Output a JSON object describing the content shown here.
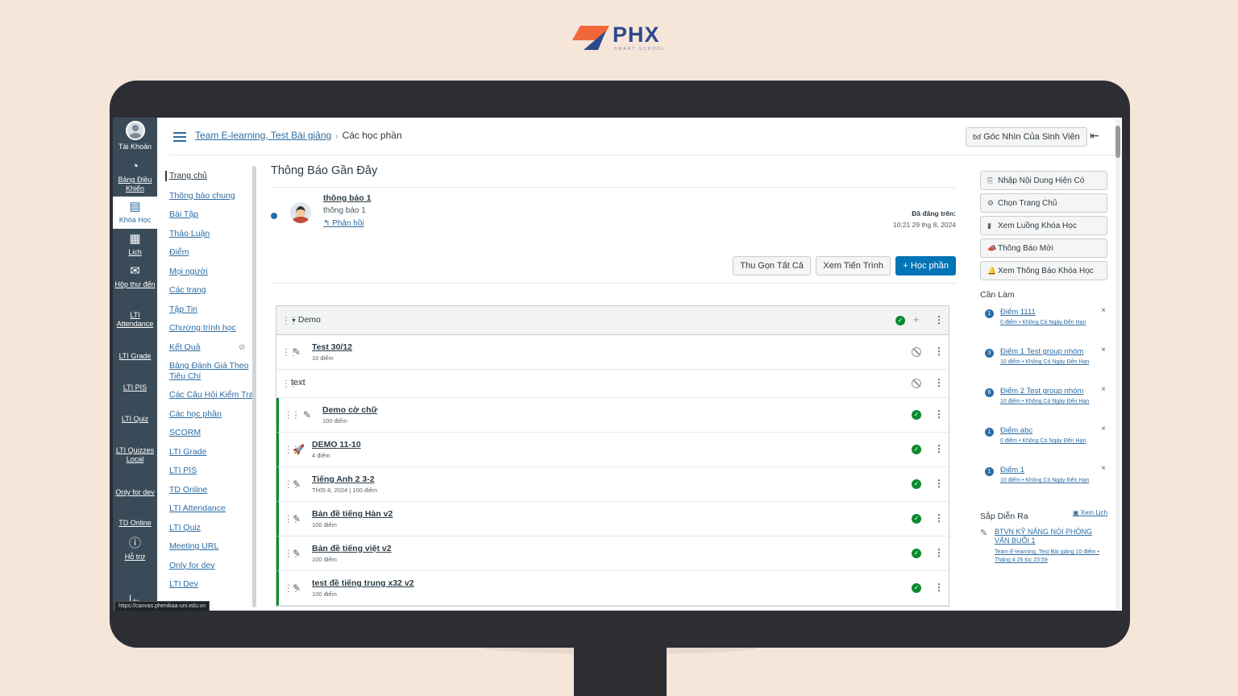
{
  "brand": {
    "name": "PHX",
    "tagline": "SMART SCHOOL"
  },
  "global_nav": [
    {
      "label": "Tài Khoản",
      "icon": "account-icon"
    },
    {
      "label": "Bảng Điều Khiển",
      "icon": "dashboard-icon"
    },
    {
      "label": "Khóa Học",
      "icon": "courses-icon",
      "active": true
    },
    {
      "label": "Lịch",
      "icon": "calendar-icon"
    },
    {
      "label": "Hộp thư đến",
      "icon": "inbox-icon"
    },
    {
      "label": "LTI Attendance"
    },
    {
      "label": "LTI Grade"
    },
    {
      "label": "LTI PIS"
    },
    {
      "label": "LTI Quiz"
    },
    {
      "label": "LTI Quizzes Local"
    },
    {
      "label": "Only for dev"
    },
    {
      "label": "TD Online"
    },
    {
      "label": "Hỗ trợ",
      "icon": "help-icon"
    }
  ],
  "status_url": "https://canvas.phenikaa-uni.edu.vn",
  "header": {
    "breadcrumb_course": "Team E-learning, Test Bài giảng",
    "breadcrumb_current": "Các học phần",
    "student_view": "Góc Nhìn Của Sinh Viên"
  },
  "course_nav": [
    "Trang chủ",
    "Thông báo chung",
    "Bài Tập",
    "Thảo Luận",
    "Điểm",
    "Mọi người",
    "Các trang",
    "Tập Tin",
    "Chương trình học",
    "Kết Quả",
    "Bảng Đánh Giá Theo Tiêu Chí",
    "Các Câu Hỏi Kiểm Tra",
    "Các học phần",
    "SCORM",
    "LTI Grade",
    "LTI PIS",
    "TD Online",
    "LTI Attendance",
    "LTI Quiz",
    "Meeting URL",
    "Only for dev",
    "LTI Dev"
  ],
  "announcements": {
    "heading": "Thông Báo Gần Đây",
    "item": {
      "title": "thông báo 1",
      "body": "thông báo 1",
      "reply": "Phản hồi",
      "posted_label": "Đã đăng trên:",
      "posted_date": "10:21 29 thg 8, 2024"
    }
  },
  "module_buttons": {
    "collapse_all": "Thu Gọn Tất Cả",
    "view_progress": "Xem Tiến Trình",
    "add_module": "+ Học phần"
  },
  "module": {
    "name": "Demo",
    "items": [
      {
        "title": "Test 30/12",
        "meta": "10 điểm",
        "icon": "assignment-icon",
        "published": false,
        "indent": false
      },
      {
        "text": "text",
        "published": false,
        "indent": false
      },
      {
        "title": "Demo cờ chữ",
        "meta": "100 điểm",
        "icon": "assignment-icon",
        "published": true,
        "indent": true
      },
      {
        "title": "DEMO 11-10",
        "meta": "4 điểm",
        "icon": "quiz-icon",
        "published": true,
        "indent": true
      },
      {
        "title": "Tiếng Anh 2 3-2",
        "meta": "Th05 8, 2024 | 100 điểm",
        "icon": "assignment-icon",
        "published": true,
        "indent": true
      },
      {
        "title": "Bản đề tiếng Hàn v2",
        "meta": "100 điểm",
        "icon": "assignment-icon",
        "published": true,
        "indent": true
      },
      {
        "title": "Bản đề tiếng việt v2",
        "meta": "100 điểm",
        "icon": "assignment-icon",
        "published": true,
        "indent": true
      },
      {
        "title": "test đề tiếng trung x32 v2",
        "meta": "100 điểm",
        "icon": "assignment-icon",
        "published": true,
        "indent": true
      }
    ]
  },
  "sidebar": {
    "buttons": [
      {
        "label": "Nhập Nội Dung Hiện Có",
        "icon": "import-icon"
      },
      {
        "label": "Chọn Trang Chủ",
        "icon": "home-settings-icon"
      },
      {
        "label": "Xem Luồng Khóa Học",
        "icon": "stream-icon"
      },
      {
        "label": "Thông Báo Mới",
        "icon": "announcement-icon"
      },
      {
        "label": "Xem Thông Báo Khóa Học",
        "icon": "bell-icon"
      }
    ],
    "todo_heading": "Cần Làm",
    "todo": [
      {
        "badge": "1",
        "title": "Điểm 1111",
        "meta": "0 điểm • Không Có Ngày Đến Hạn"
      },
      {
        "badge": "3",
        "title": "Điểm 1 Test group nhóm",
        "meta": "10 điểm • Không Có Ngày Đến Hạn"
      },
      {
        "badge": "6",
        "title": "Điểm 2 Test group nhóm",
        "meta": "10 điểm • Không Có Ngày Đến Hạn"
      },
      {
        "badge": "1",
        "title": "Điểm abc",
        "meta": "0 điểm • Không Có Ngày Đến Hạn"
      },
      {
        "badge": "1",
        "title": "Điểm 1",
        "meta": "10 điểm • Không Có Ngày Đến Hạn"
      }
    ],
    "upcoming_heading": "Sắp Diễn Ra",
    "calendar_link": "Xem Lịch",
    "upcoming": {
      "title": "BTVN KỸ NĂNG NÓI PHÒNG VẤN BUỔI 1",
      "meta": "Team E-learning, Test Bài giảng 10 điểm • Tháng 4 26 lúc 23:59"
    }
  }
}
